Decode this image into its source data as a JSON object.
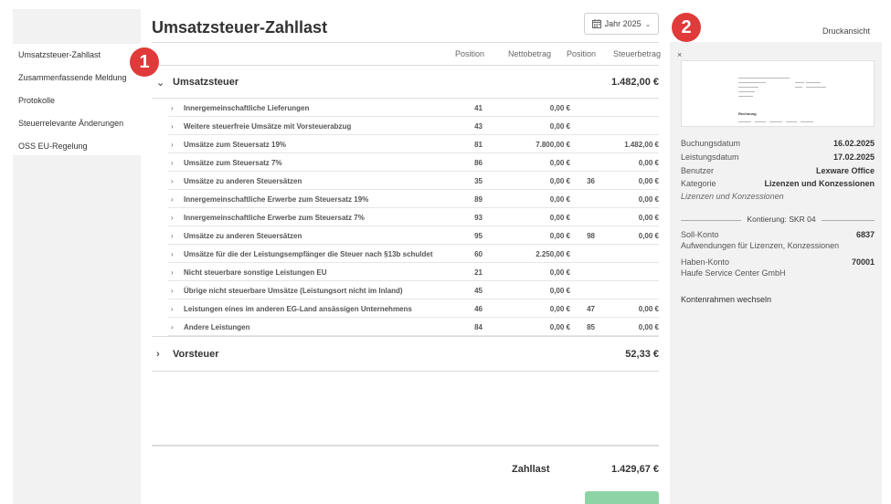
{
  "sidebar": {
    "items": [
      {
        "label": "Umsatzsteuer-Zahllast"
      },
      {
        "label": "Zusammenfassende Meldung"
      },
      {
        "label": "Protokolle"
      },
      {
        "label": "Steuerrelevante Änderungen"
      },
      {
        "label": "OSS EU-Regelung"
      }
    ]
  },
  "header": {
    "title": "Umsatzsteuer-Zahllast",
    "year_button": "Jahr 2025",
    "print_link": "Druckansicht"
  },
  "columns": [
    "Position",
    "Nettobetrag",
    "Position",
    "Steuerbetrag"
  ],
  "groups": [
    {
      "label": "Umsatzsteuer",
      "value": "1.482,00 €",
      "rows": [
        {
          "label": "Innergemeinschaftliche Lieferungen",
          "pos": "41",
          "net": "0,00 €",
          "pos2": "",
          "tax": ""
        },
        {
          "label": "Weitere steuerfreie Umsätze mit Vorsteuerabzug",
          "pos": "43",
          "net": "0,00 €",
          "pos2": "",
          "tax": ""
        },
        {
          "label": "Umsätze zum Steuersatz 19%",
          "pos": "81",
          "net": "7.800,00 €",
          "pos2": "",
          "tax": "1.482,00 €"
        },
        {
          "label": "Umsätze zum Steuersatz 7%",
          "pos": "86",
          "net": "0,00 €",
          "pos2": "",
          "tax": "0,00 €"
        },
        {
          "label": "Umsätze zu anderen Steuersätzen",
          "pos": "35",
          "net": "0,00 €",
          "pos2": "36",
          "tax": "0,00 €"
        },
        {
          "label": "Innergemeinschaftliche Erwerbe zum Steuersatz 19%",
          "pos": "89",
          "net": "0,00 €",
          "pos2": "",
          "tax": "0,00 €"
        },
        {
          "label": "Innergemeinschaftliche Erwerbe zum Steuersatz 7%",
          "pos": "93",
          "net": "0,00 €",
          "pos2": "",
          "tax": "0,00 €"
        },
        {
          "label": "Umsätze zu anderen Steuersätzen",
          "pos": "95",
          "net": "0,00 €",
          "pos2": "98",
          "tax": "0,00 €"
        },
        {
          "label": "Umsätze für die der Leistungsempfänger die Steuer nach §13b schuldet",
          "pos": "60",
          "net": "2.250,00 €",
          "pos2": "",
          "tax": ""
        },
        {
          "label": "Nicht steuerbare sonstige Leistungen EU",
          "pos": "21",
          "net": "0,00 €",
          "pos2": "",
          "tax": ""
        },
        {
          "label": "Übrige nicht steuerbare Umsätze (Leistungsort nicht im Inland)",
          "pos": "45",
          "net": "0,00 €",
          "pos2": "",
          "tax": ""
        },
        {
          "label": "Leistungen eines im anderen EG-Land ansässigen Unternehmens",
          "pos": "46",
          "net": "0,00 €",
          "pos2": "47",
          "tax": "0,00 €"
        },
        {
          "label": "Andere Leistungen",
          "pos": "84",
          "net": "0,00 €",
          "pos2": "85",
          "tax": "0,00 €"
        }
      ]
    },
    {
      "label": "Vorsteuer",
      "value": "52,33 €",
      "rows": []
    }
  ],
  "total": {
    "label": "Zahllast",
    "value": "1.429,67 €"
  },
  "panel": {
    "close": "×",
    "preview_title": "Rechnung",
    "fields": [
      {
        "key": "Buchungsdatum",
        "value": "16.02.2025"
      },
      {
        "key": "Leistungsdatum",
        "value": "17.02.2025"
      },
      {
        "key": "Benutzer",
        "value": "Lexware Office"
      },
      {
        "key": "Kategorie",
        "value": "Lizenzen und Konzessionen"
      }
    ],
    "note": "Lizenzen und Konzessionen",
    "kontierung": "Kontierung: SKR 04",
    "soll": {
      "label": "Soll-Konto",
      "number": "6837",
      "desc": "Aufwendungen für Lizenzen, Konzessionen"
    },
    "haben": {
      "label": "Haben-Konto",
      "number": "70001",
      "desc": "Haufe Service Center GmbH"
    },
    "switch_link": "Kontenrahmen wechseln"
  },
  "badges": [
    "1",
    "2"
  ],
  "colors": {
    "badge": "#e03a3a",
    "panel_bg": "#f2f2f2",
    "green_button": "#8ed3a6"
  }
}
